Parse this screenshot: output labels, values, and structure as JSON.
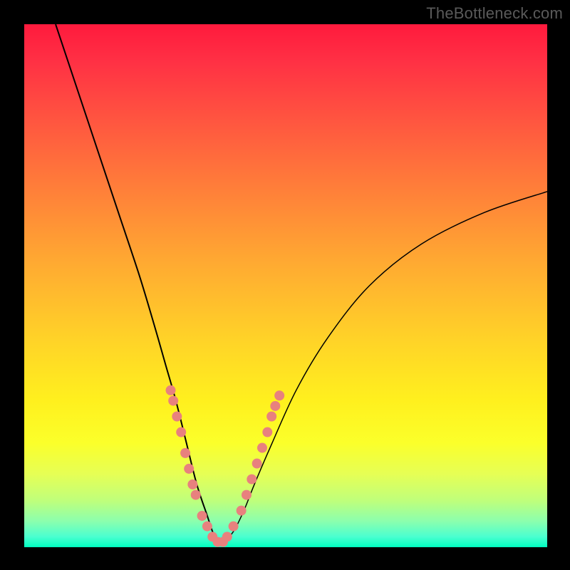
{
  "watermark": "TheBottleneck.com",
  "chart_data": {
    "type": "line",
    "title": "",
    "xlabel": "",
    "ylabel": "",
    "xlim": [
      0,
      100
    ],
    "ylim": [
      0,
      100
    ],
    "series": [
      {
        "name": "bottleneck-curve",
        "x": [
          6,
          10,
          14,
          18,
          22,
          25,
          27,
          29,
          31,
          33,
          35,
          36,
          37,
          38,
          40,
          42,
          44,
          47,
          52,
          58,
          66,
          76,
          88,
          100
        ],
        "y": [
          100,
          88,
          76,
          64,
          52,
          42,
          35,
          28,
          20,
          12,
          6,
          3,
          1,
          1,
          3,
          7,
          12,
          19,
          30,
          40,
          50,
          58,
          64,
          68
        ]
      }
    ],
    "markers": {
      "name": "highlight-points",
      "color": "#e8817e",
      "points": [
        {
          "x": 28.0,
          "y": 30
        },
        {
          "x": 28.5,
          "y": 28
        },
        {
          "x": 29.2,
          "y": 25
        },
        {
          "x": 30.0,
          "y": 22
        },
        {
          "x": 30.8,
          "y": 18
        },
        {
          "x": 31.5,
          "y": 15
        },
        {
          "x": 32.2,
          "y": 12
        },
        {
          "x": 32.8,
          "y": 10
        },
        {
          "x": 34.0,
          "y": 6
        },
        {
          "x": 35.0,
          "y": 4
        },
        {
          "x": 36.0,
          "y": 2
        },
        {
          "x": 37.0,
          "y": 1
        },
        {
          "x": 38.0,
          "y": 1
        },
        {
          "x": 38.8,
          "y": 2
        },
        {
          "x": 40.0,
          "y": 4
        },
        {
          "x": 41.5,
          "y": 7
        },
        {
          "x": 42.5,
          "y": 10
        },
        {
          "x": 43.5,
          "y": 13
        },
        {
          "x": 44.5,
          "y": 16
        },
        {
          "x": 45.5,
          "y": 19
        },
        {
          "x": 46.5,
          "y": 22
        },
        {
          "x": 47.3,
          "y": 25
        },
        {
          "x": 48.0,
          "y": 27
        },
        {
          "x": 48.8,
          "y": 29
        }
      ]
    },
    "gradient_axis": {
      "description": "vertical gradient red(top)->yellow->green(bottom) representing bottleneck severity",
      "stops": [
        {
          "pos": 0,
          "color": "#ff1a3d"
        },
        {
          "pos": 50,
          "color": "#ffd228"
        },
        {
          "pos": 100,
          "color": "#00ffc0"
        }
      ]
    }
  }
}
